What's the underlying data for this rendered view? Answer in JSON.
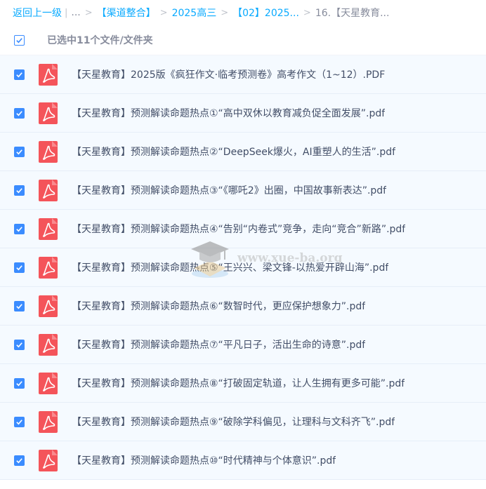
{
  "breadcrumb": {
    "back": "返回上一级",
    "ellipsis": "...",
    "items": [
      "【渠道整合】",
      "2025高三",
      "【02】2025...",
      "16.【天星教育..."
    ]
  },
  "selection": {
    "label": "已选中11个文件/文件夹"
  },
  "files": [
    "【天星教育】2025版《疯狂作文·临考预测卷》高考作文（1~12）.PDF",
    "【天星教育】预测解读命题热点①“高中双休以教育减负促全面发展”.pdf",
    "【天星教育】预测解读命题热点②“DeepSeek爆火，AI重塑人的生活”.pdf",
    "【天星教育】预测解读命题热点③“《哪吒2》出圈，中国故事新表达”.pdf",
    "【天星教育】预测解读命题热点④“告别“内卷式”竞争，走向“竞合”新路”.pdf",
    "【天星教育】预测解读命题热点⑤“王兴兴、梁文锋-以热爱开辟山海”.pdf",
    "【天星教育】预测解读命题热点⑥“数智时代，更应保护想象力”.pdf",
    "【天星教育】预测解读命题热点⑦“平凡日子，活出生命的诗意”.pdf",
    "【天星教育】预测解读命题热点⑧“打破固定轨道，让人生拥有更多可能”.pdf",
    "【天星教育】预测解读命题热点⑨“破除学科偏见，让理科与文科齐飞”.pdf",
    "【天星教育】预测解读命题热点⑩“时代精神与个体意识”.pdf"
  ],
  "watermark": {
    "text": "www.xue-ba.org"
  },
  "icons": {
    "checkbox": "checkbox-checked-icon",
    "file": "pdf-file-icon",
    "watermark": "graduation-cap-icon"
  },
  "colors": {
    "accent": "#09aaff",
    "checkbox": "#3b8cff",
    "pdf": "#f4545a",
    "row_bg": "#f5faff"
  }
}
